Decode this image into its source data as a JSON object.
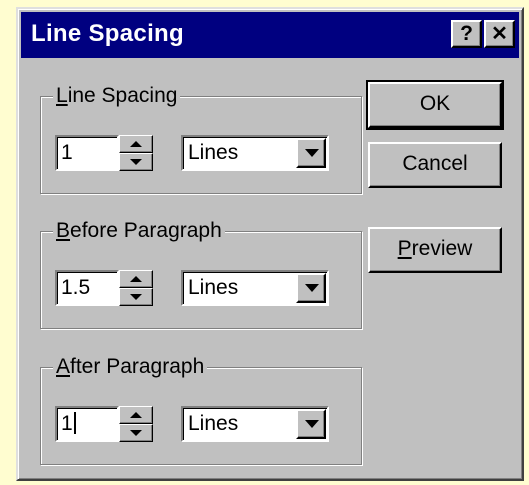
{
  "dialog": {
    "title": "Line Spacing",
    "help_label": "?",
    "close_label": "✕"
  },
  "groups": [
    {
      "label_accel": "L",
      "label_rest": "ine Spacing",
      "value": "1",
      "unit": "Lines"
    },
    {
      "label_accel": "B",
      "label_rest": "efore Paragraph",
      "value": "1.5",
      "unit": "Lines"
    },
    {
      "label_accel": "A",
      "label_rest": "fter Paragraph",
      "value": "1",
      "unit": "Lines"
    }
  ],
  "buttons": {
    "ok": "OK",
    "cancel": "Cancel",
    "preview_accel": "P",
    "preview_rest": "review"
  },
  "colors": {
    "title_bar": "#000080",
    "face": "#c0c0c0",
    "page_background": "#fffdd0"
  }
}
